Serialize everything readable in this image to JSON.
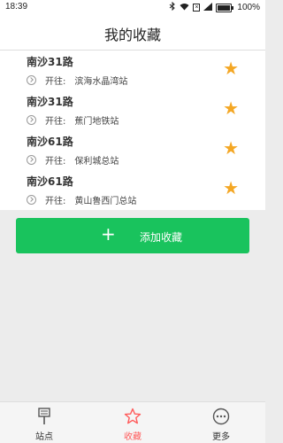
{
  "status_bar": {
    "time": "18:39",
    "battery": "100%"
  },
  "header": {
    "title": "我的收藏"
  },
  "favorites": [
    {
      "route": "南沙31路",
      "direction_label": "开往:",
      "destination": "滨海水晶湾站"
    },
    {
      "route": "南沙31路",
      "direction_label": "开往:",
      "destination": "蕉门地铁站"
    },
    {
      "route": "南沙61路",
      "direction_label": "开往:",
      "destination": "保利城总站"
    },
    {
      "route": "南沙61路",
      "direction_label": "开往:",
      "destination": "黄山鲁西门总站"
    }
  ],
  "add_button": {
    "label": "添加收藏"
  },
  "tabs": [
    {
      "label": "站点",
      "icon": "bus-stop-icon"
    },
    {
      "label": "收藏",
      "icon": "star-outline-icon",
      "active": true
    },
    {
      "label": "更多",
      "icon": "more-icon"
    }
  ],
  "colors": {
    "accent_green": "#19c35d",
    "star": "#f4a724",
    "active_tab": "#ff5b5b"
  }
}
